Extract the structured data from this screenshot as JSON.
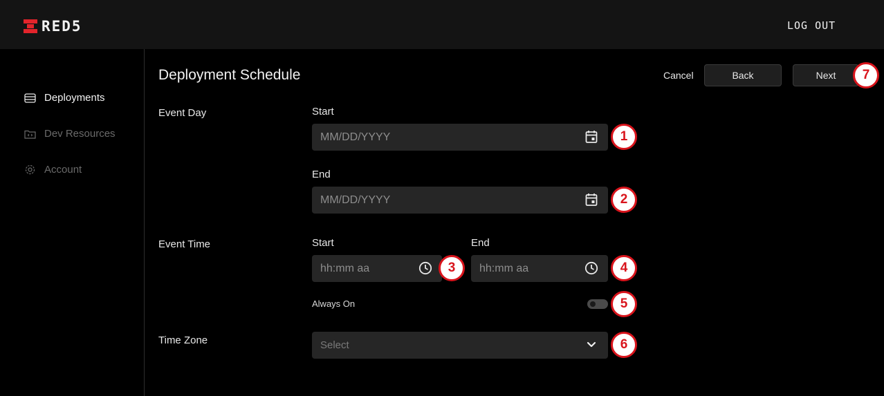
{
  "header": {
    "logo_text": "RED5",
    "logout_label": "LOG OUT"
  },
  "sidebar": {
    "items": [
      {
        "label": "Deployments",
        "icon": "stack-icon",
        "active": true
      },
      {
        "label": "Dev Resources",
        "icon": "folder-code-icon",
        "active": false
      },
      {
        "label": "Account",
        "icon": "gear-icon",
        "active": false
      }
    ]
  },
  "page": {
    "title": "Deployment Schedule",
    "cancel_label": "Cancel",
    "back_label": "Back",
    "next_label": "Next"
  },
  "event_day": {
    "section_label": "Event Day",
    "start_label": "Start",
    "start_placeholder": "MM/DD/YYYY",
    "end_label": "End",
    "end_placeholder": "MM/DD/YYYY"
  },
  "event_time": {
    "section_label": "Event Time",
    "start_label": "Start",
    "start_placeholder": "hh:mm aa",
    "end_label": "End",
    "end_placeholder": "hh:mm aa",
    "always_on_label": "Always On",
    "always_on": false
  },
  "time_zone": {
    "section_label": "Time Zone",
    "placeholder": "Select"
  },
  "callouts": [
    "1",
    "2",
    "3",
    "4",
    "5",
    "6",
    "7"
  ],
  "colors": {
    "accent": "#e3242b",
    "callout": "#d9141c",
    "background": "#000000",
    "topbar": "#141414",
    "input": "#262626"
  }
}
